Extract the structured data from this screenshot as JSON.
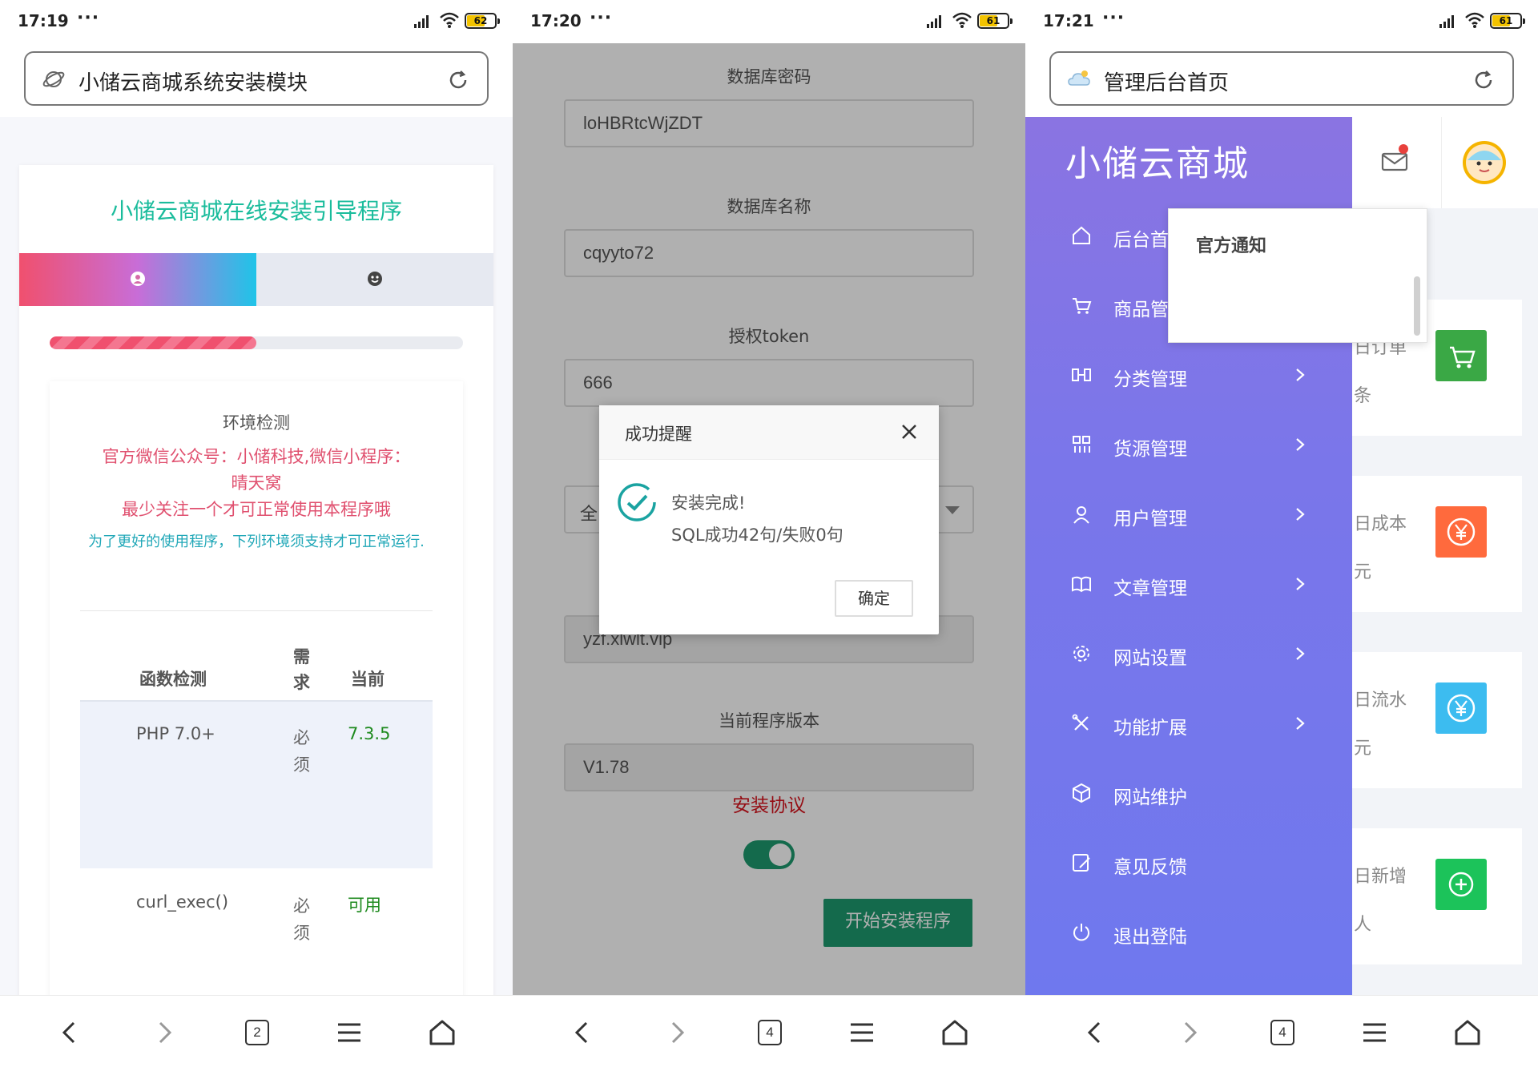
{
  "phones": [
    {
      "status": {
        "time": "17:19",
        "dots": "···",
        "battery": "62"
      },
      "url": {
        "title": "小储云商城系统安装模块"
      },
      "nav": {
        "tab_count": "2"
      }
    },
    {
      "status": {
        "time": "17:20",
        "dots": "···",
        "battery": "61"
      },
      "nav": {
        "tab_count": "4"
      }
    },
    {
      "status": {
        "time": "17:21",
        "dots": "···",
        "battery": "61"
      },
      "url": {
        "title": "管理后台首页"
      },
      "nav": {
        "tab_count": "4"
      }
    }
  ],
  "installer": {
    "title": "小储云商城在线安装引导程序",
    "progress_fraction": 0.5,
    "env_heading": "环境检测",
    "notice_pink_lines": [
      "官方微信公众号：小储科技,微信小程序：",
      "晴天窝",
      "最少关注一个才可正常使用本程序哦"
    ],
    "notice_teal": "为了更好的使用程序，下列环境须支持才可正常运行.",
    "table": {
      "headers": [
        "函数检测",
        "需求",
        "当前"
      ],
      "rows": [
        {
          "name": "PHP 7.0+",
          "req": "必须",
          "cur": "7.3.5"
        },
        {
          "name": "curl_exec()",
          "req": "必须",
          "cur": "可用"
        }
      ]
    }
  },
  "form": {
    "db_password_label": "数据库密码",
    "db_password_value": "loHBRtcWjZDT",
    "db_name_label": "数据库名称",
    "db_name_value": "cqyyto72",
    "token_label": "授权token",
    "token_value": "666",
    "select_value": "全",
    "domain_value": "yzf.xlwlt.vip",
    "version_label": "当前程序版本",
    "version_value": "V1.78",
    "agreement": "安装协议",
    "agreement_enabled": true,
    "install_button": "开始安装程序"
  },
  "modal": {
    "title": "成功提醒",
    "message_line1": "安装完成!",
    "message_line2": "SQL成功42句/失败0句",
    "confirm": "确定"
  },
  "admin": {
    "brand": "小储云商城",
    "menu": [
      {
        "label": "后台首",
        "icon": "home-icon",
        "chevron": false
      },
      {
        "label": "商品管",
        "icon": "cart-icon",
        "chevron": false
      },
      {
        "label": "分类管理",
        "icon": "category-icon",
        "chevron": true
      },
      {
        "label": "货源管理",
        "icon": "grid-icon",
        "chevron": true
      },
      {
        "label": "用户管理",
        "icon": "user-icon",
        "chevron": true
      },
      {
        "label": "文章管理",
        "icon": "book-icon",
        "chevron": true
      },
      {
        "label": "网站设置",
        "icon": "gear-icon",
        "chevron": true
      },
      {
        "label": "功能扩展",
        "icon": "tools-icon",
        "chevron": true
      },
      {
        "label": "网站维护",
        "icon": "cube-icon",
        "chevron": false
      },
      {
        "label": "意见反馈",
        "icon": "feedback-icon",
        "chevron": false
      },
      {
        "label": "退出登陆",
        "icon": "power-icon",
        "chevron": false
      }
    ],
    "dropdown_title": "官方通知",
    "stat_cards": [
      {
        "label": "日订单",
        "value": "条",
        "color": "#3aa845",
        "icon": "cart-icon"
      },
      {
        "label": "日成本",
        "value": "元",
        "color": "#ff6a3d",
        "icon": "yen-icon"
      },
      {
        "label": "日流水",
        "value": "元",
        "color": "#3cbcf0",
        "icon": "yen-icon"
      },
      {
        "label": "日新增",
        "value": "人",
        "color": "#1cc35a",
        "icon": "plus-icon"
      }
    ]
  },
  "colors": {
    "installer_title": "#1abc9c",
    "install_button": "#1e9a6e",
    "agreement": "#d8141e",
    "sidebar_top": "#8a74e2",
    "sidebar_bottom": "#6f78ee"
  }
}
